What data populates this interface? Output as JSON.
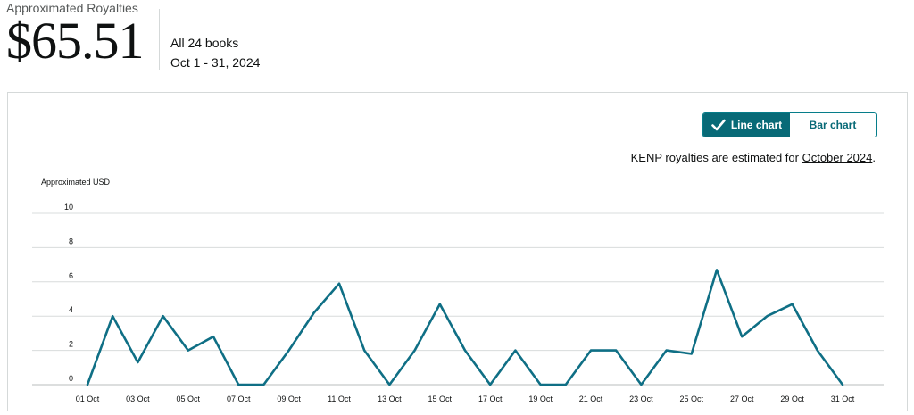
{
  "header": {
    "label": "Approximated Royalties",
    "amount": "$65.51",
    "books": "All 24 books",
    "period": "Oct 1 - 31, 2024"
  },
  "toggle": {
    "line_label": "Line chart",
    "bar_label": "Bar chart",
    "active": "line"
  },
  "notice": {
    "prefix": "KENP royalties are estimated for ",
    "link": "October 2024",
    "suffix": "."
  },
  "colors": {
    "accent": "#086a77",
    "line": "#0f6f85",
    "grid": "#d8dcdc"
  },
  "chart_data": {
    "type": "line",
    "ylabel": "Approximated USD",
    "xlabel": "",
    "ylim": [
      0,
      10
    ],
    "yticks": [
      0,
      2,
      4,
      6,
      8,
      10
    ],
    "grid": true,
    "categories": [
      "01 Oct",
      "02 Oct",
      "03 Oct",
      "04 Oct",
      "05 Oct",
      "06 Oct",
      "07 Oct",
      "08 Oct",
      "09 Oct",
      "10 Oct",
      "11 Oct",
      "12 Oct",
      "13 Oct",
      "14 Oct",
      "15 Oct",
      "16 Oct",
      "17 Oct",
      "18 Oct",
      "19 Oct",
      "20 Oct",
      "21 Oct",
      "22 Oct",
      "23 Oct",
      "24 Oct",
      "25 Oct",
      "26 Oct",
      "27 Oct",
      "28 Oct",
      "29 Oct",
      "30 Oct",
      "31 Oct"
    ],
    "tick_labels": [
      "01 Oct",
      "03 Oct",
      "05 Oct",
      "07 Oct",
      "09 Oct",
      "11 Oct",
      "13 Oct",
      "15 Oct",
      "17 Oct",
      "19 Oct",
      "21 Oct",
      "23 Oct",
      "25 Oct",
      "27 Oct",
      "29 Oct",
      "31 Oct"
    ],
    "values": [
      0,
      4.0,
      1.3,
      4.0,
      2.0,
      2.8,
      0,
      0,
      2.0,
      4.2,
      5.9,
      2.0,
      0,
      2.0,
      4.7,
      2.0,
      0,
      2.0,
      0,
      0,
      2.0,
      2.0,
      0,
      2.0,
      1.8,
      6.7,
      2.8,
      4.0,
      4.7,
      2.0,
      0
    ]
  }
}
